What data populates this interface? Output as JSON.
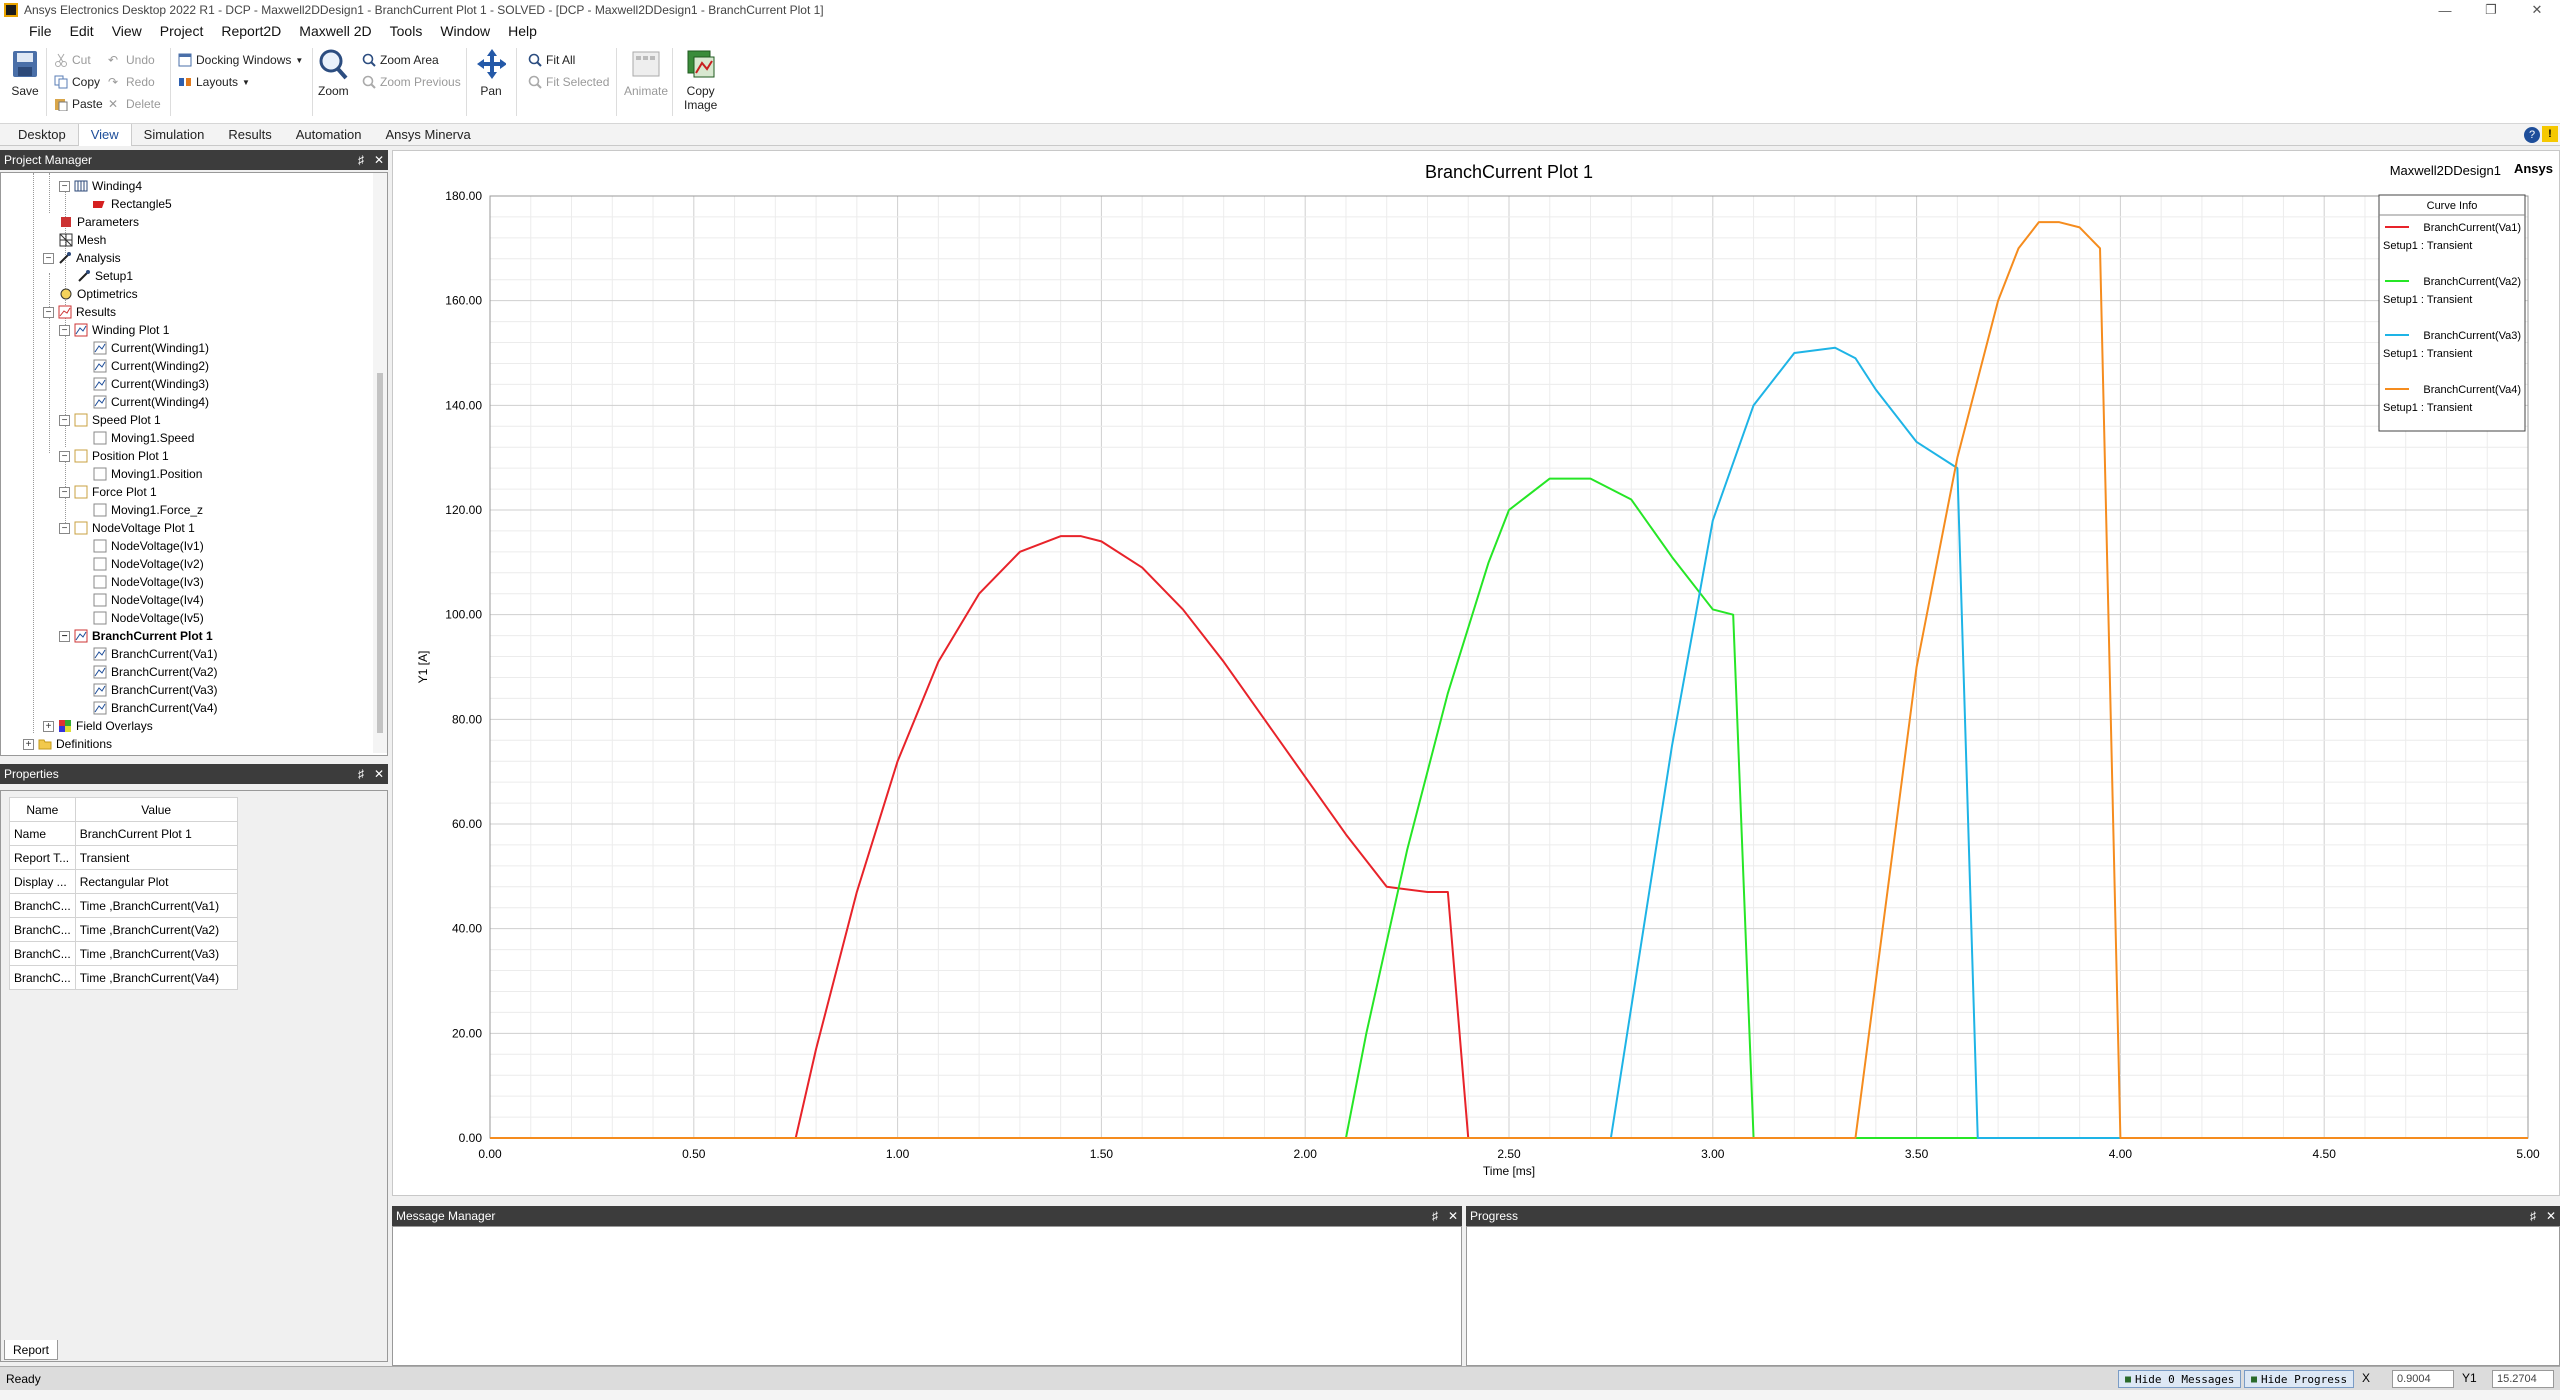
{
  "titlebar": {
    "title": "Ansys Electronics Desktop 2022 R1 - DCP - Maxwell2DDesign1 - BranchCurrent Plot 1 - SOLVED - [DCP - Maxwell2DDesign1 - BranchCurrent Plot 1]"
  },
  "menu": [
    "File",
    "Edit",
    "View",
    "Project",
    "Report2D",
    "Maxwell 2D",
    "Tools",
    "Window",
    "Help"
  ],
  "ribbon": {
    "save": "Save",
    "cut": "Cut",
    "copy": "Copy",
    "paste": "Paste",
    "undo": "Undo",
    "redo": "Redo",
    "delete": "Delete",
    "docking_windows": "Docking Windows",
    "layouts": "Layouts",
    "zoom": "Zoom",
    "zoom_area": "Zoom Area",
    "zoom_previous": "Zoom Previous",
    "pan": "Pan",
    "fit_all": "Fit All",
    "fit_selected": "Fit Selected",
    "animate": "Animate",
    "copy_image_1": "Copy",
    "copy_image_2": "Image"
  },
  "ribbon_tabs": [
    "Desktop",
    "View",
    "Simulation",
    "Results",
    "Automation",
    "Ansys Minerva"
  ],
  "project_manager": {
    "title": "Project Manager",
    "tree": {
      "winding4": "Winding4",
      "rectangle5": "Rectangle5",
      "parameters": "Parameters",
      "mesh": "Mesh",
      "analysis": "Analysis",
      "setup1": "Setup1",
      "optimetrics": "Optimetrics",
      "results": "Results",
      "winding_plot": "Winding Plot 1",
      "winding_items": [
        "Current(Winding1)",
        "Current(Winding2)",
        "Current(Winding3)",
        "Current(Winding4)"
      ],
      "speed_plot": "Speed Plot 1",
      "speed_item": "Moving1.Speed",
      "position_plot": "Position Plot 1",
      "position_item": "Moving1.Position",
      "force_plot": "Force Plot 1",
      "force_item": "Moving1.Force_z",
      "nodevoltage_plot": "NodeVoltage Plot 1",
      "nodevoltage_items": [
        "NodeVoltage(Iv1)",
        "NodeVoltage(Iv2)",
        "NodeVoltage(Iv3)",
        "NodeVoltage(Iv4)",
        "NodeVoltage(Iv5)"
      ],
      "branch_plot": "BranchCurrent Plot 1",
      "branch_items": [
        "BranchCurrent(Va1)",
        "BranchCurrent(Va2)",
        "BranchCurrent(Va3)",
        "BranchCurrent(Va4)"
      ],
      "field_overlays": "Field Overlays",
      "definitions": "Definitions"
    }
  },
  "properties": {
    "title": "Properties",
    "headers": [
      "Name",
      "Value"
    ],
    "rows": [
      [
        "Name",
        "BranchCurrent Plot 1"
      ],
      [
        "Report T...",
        "Transient"
      ],
      [
        "Display ...",
        "Rectangular Plot"
      ],
      [
        "BranchC...",
        "Time ,BranchCurrent(Va1)"
      ],
      [
        "BranchC...",
        "Time ,BranchCurrent(Va2)"
      ],
      [
        "BranchC...",
        "Time ,BranchCurrent(Va3)"
      ],
      [
        "BranchC...",
        "Time ,BranchCurrent(Va4)"
      ]
    ],
    "tab": "Report"
  },
  "plot_header": {
    "design": "Maxwell2DDesign1",
    "brand": "Ansys"
  },
  "legend_title": "Curve Info",
  "message_manager": {
    "title": "Message Manager"
  },
  "progress": {
    "title": "Progress"
  },
  "status": {
    "text": "Ready",
    "hide_messages": "Hide 0 Messages",
    "hide_progress": "Hide Progress",
    "x_label": "X",
    "x_value": "0.9004",
    "y_label": "Y1",
    "y_value": "15.2704"
  },
  "colors": {
    "va1": "#e8232a",
    "va2": "#26e626",
    "va3": "#1eb4e6",
    "va4": "#f58c1e"
  },
  "chart_data": {
    "type": "line",
    "title": "BranchCurrent Plot 1",
    "xlabel": "Time [ms]",
    "ylabel": "Y1 [A]",
    "xlim": [
      0,
      5
    ],
    "ylim": [
      0,
      180
    ],
    "xticks": [
      "0.00",
      "0.50",
      "1.00",
      "1.50",
      "2.00",
      "2.50",
      "3.00",
      "3.50",
      "4.00",
      "4.50",
      "5.00"
    ],
    "yticks": [
      "0.00",
      "20.00",
      "40.00",
      "60.00",
      "80.00",
      "100.00",
      "120.00",
      "140.00",
      "160.00",
      "180.00"
    ],
    "grid": true,
    "legend_position": "top-right",
    "series": [
      {
        "name": "BranchCurrent(Va1)",
        "setup": "Setup1 : Transient",
        "x": [
          0,
          0.75,
          0.8,
          0.9,
          1.0,
          1.1,
          1.2,
          1.3,
          1.4,
          1.45,
          1.5,
          1.6,
          1.7,
          1.8,
          1.9,
          2.0,
          2.1,
          2.2,
          2.3,
          2.35,
          2.4,
          2.42,
          5.0
        ],
        "y": [
          0,
          0,
          17,
          47,
          72,
          91,
          104,
          112,
          115,
          115,
          114,
          109,
          101,
          91,
          80,
          69,
          58,
          48,
          47,
          47,
          0,
          0,
          0
        ]
      },
      {
        "name": "BranchCurrent(Va2)",
        "setup": "Setup1 : Transient",
        "x": [
          0,
          2.1,
          2.15,
          2.25,
          2.35,
          2.45,
          2.5,
          2.6,
          2.7,
          2.8,
          2.9,
          3.0,
          3.05,
          3.1,
          3.12,
          5.0
        ],
        "y": [
          0,
          0,
          20,
          55,
          85,
          110,
          120,
          126,
          126,
          122,
          111,
          101,
          100,
          0,
          0,
          0
        ]
      },
      {
        "name": "BranchCurrent(Va3)",
        "setup": "Setup1 : Transient",
        "x": [
          0,
          2.75,
          2.8,
          2.9,
          3.0,
          3.1,
          3.2,
          3.3,
          3.35,
          3.4,
          3.5,
          3.6,
          3.65,
          3.67,
          5.0
        ],
        "y": [
          0,
          0,
          25,
          75,
          118,
          140,
          150,
          151,
          149,
          143,
          133,
          128,
          0,
          0,
          0
        ]
      },
      {
        "name": "BranchCurrent(Va4)",
        "setup": "Setup1 : Transient",
        "x": [
          0,
          3.35,
          3.4,
          3.5,
          3.6,
          3.7,
          3.75,
          3.8,
          3.85,
          3.9,
          3.95,
          4.0,
          4.02,
          5.0
        ],
        "y": [
          0,
          0,
          30,
          90,
          130,
          160,
          170,
          175,
          175,
          174,
          170,
          0,
          0,
          0
        ]
      }
    ]
  }
}
